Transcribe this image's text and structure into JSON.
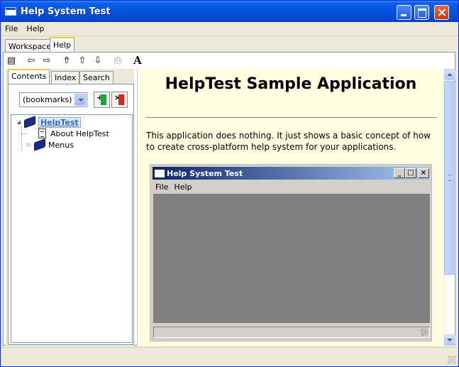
{
  "window": {
    "title": "Help System Test"
  },
  "menubar": {
    "items": [
      "File",
      "Help"
    ]
  },
  "top_tabs": {
    "workspace": "Workspace",
    "help": "Help"
  },
  "toolbar": {
    "icons": [
      "contents-toggle-icon",
      "back-arrow-icon",
      "forward-arrow-icon",
      "home-icon",
      "up-arrow-icon",
      "down-arrow-icon",
      "print-icon",
      "font-icon"
    ],
    "font_glyph": "A"
  },
  "nav_tabs": {
    "contents": "Contents",
    "index": "Index",
    "search": "Search"
  },
  "bookmarks": {
    "selected": "(bookmarks)"
  },
  "tree": {
    "root": "HelpTest",
    "children": [
      "About HelpTest",
      "Menus"
    ]
  },
  "content": {
    "heading": "HelpTest Sample Application",
    "paragraph": "This application does nothing. It just shows a basic concept of how to create cross-platform help system for your applications.",
    "screenshot": {
      "title": "Help System Test",
      "menu": [
        "File",
        "Help"
      ]
    }
  },
  "colors": {
    "titlebar": "#0653e0",
    "content_bg": "#ffffe2",
    "selection": "#316ac5"
  }
}
